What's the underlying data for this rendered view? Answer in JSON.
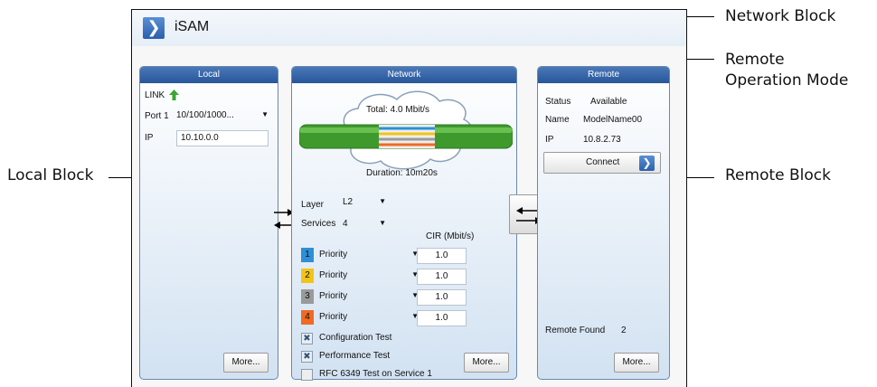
{
  "app": {
    "title": "iSAM"
  },
  "callouts": {
    "network_block": "Network Block",
    "remote_mode_line1": "Remote",
    "remote_mode_line2": "Operation Mode",
    "local_block": "Local Block",
    "remote_block": "Remote Block"
  },
  "local": {
    "header": "Local",
    "link_label": "LINK",
    "port_label": "Port 1",
    "port_value": "10/100/1000...",
    "ip_label": "IP",
    "ip_value": "10.10.0.0",
    "more_button": "More..."
  },
  "network": {
    "header": "Network",
    "total": "Total: 4.0 Mbit/s",
    "duration": "Duration: 10m20s",
    "layer_label": "Layer",
    "layer_value": "L2",
    "services_label": "Services",
    "services_value": "4",
    "cir_header": "CIR (Mbit/s)",
    "services": [
      {
        "num": "1",
        "type": "Priority",
        "cir": "1.0",
        "color": "#2f8fd6"
      },
      {
        "num": "2",
        "type": "Priority",
        "cir": "1.0",
        "color": "#f2c418"
      },
      {
        "num": "3",
        "type": "Priority",
        "cir": "1.0",
        "color": "#9a9a9a"
      },
      {
        "num": "4",
        "type": "Priority",
        "cir": "1.0",
        "color": "#ef6a23"
      }
    ],
    "config_test": "Configuration Test",
    "perf_test": "Performance Test",
    "rfc_test": "RFC 6349 Test on Service 1",
    "more_button": "More..."
  },
  "remote": {
    "header": "Remote",
    "status_label": "Status",
    "status_value": "Available",
    "name_label": "Name",
    "name_value": "ModelName00",
    "ip_label": "IP",
    "ip_value": "10.8.2.73",
    "connect_button": "Connect",
    "found_label": "Remote Found",
    "found_value": "2",
    "more_button": "More..."
  },
  "colors": {
    "accent": "#27569a",
    "link_up": "#3aa635",
    "pipe": "#3f9a2e"
  }
}
